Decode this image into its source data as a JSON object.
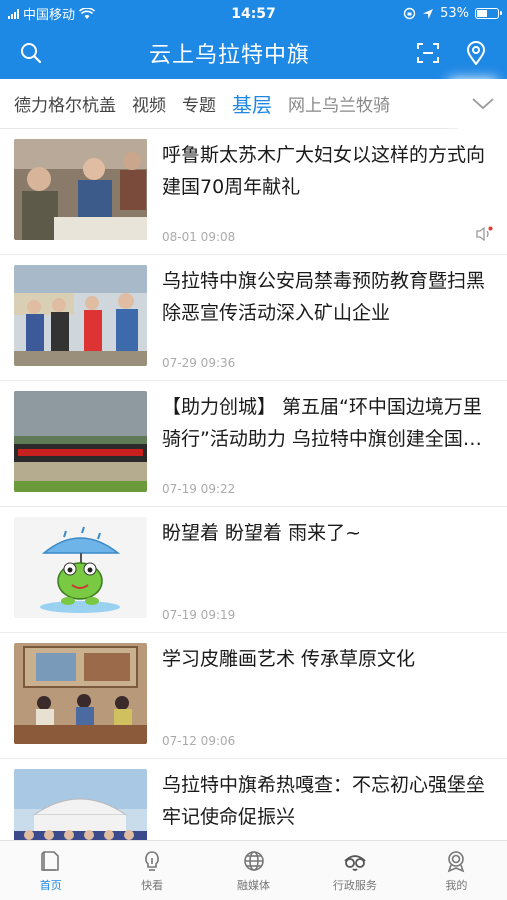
{
  "status": {
    "carrier": "中国移动",
    "time": "14:57",
    "battery": "53%",
    "battery_level": 0.53
  },
  "header": {
    "title": "云上乌拉特中旗"
  },
  "tabs": [
    {
      "label": "德力格尔杭盖"
    },
    {
      "label": "视频"
    },
    {
      "label": "专题"
    },
    {
      "label": "基层"
    },
    {
      "label": "网上乌兰牧骑"
    }
  ],
  "news": [
    {
      "title": "呼鲁斯太苏木广大妇女以这样的方式向建国70周年献礼",
      "date": "08-01 09:08"
    },
    {
      "title": "乌拉特中旗公安局禁毒预防教育暨扫黑除恶宣传活动深入矿山企业",
      "date": "07-29 09:36"
    },
    {
      "title": "【助力创城】 第五届“环中国边境万里骑行”活动助力 乌拉特中旗创建全国文明城市",
      "date": "07-19 09:22"
    },
    {
      "title": "盼望着 盼望着 雨来了~",
      "date": "07-19 09:19"
    },
    {
      "title": "学习皮雕画艺术 传承草原文化",
      "date": "07-12 09:06"
    },
    {
      "title": "乌拉特中旗希热嘎查：不忘初心强堡垒 牢记使命促振兴",
      "date": ""
    }
  ],
  "bottom_nav": [
    {
      "label": "首页",
      "icon": "home-icon"
    },
    {
      "label": "快看",
      "icon": "lightbulb-icon"
    },
    {
      "label": "融媒体",
      "icon": "globe-icon"
    },
    {
      "label": "行政服务",
      "icon": "service-icon"
    },
    {
      "label": "我的",
      "icon": "profile-icon"
    }
  ],
  "colors": {
    "brand": "#1e88e5"
  }
}
